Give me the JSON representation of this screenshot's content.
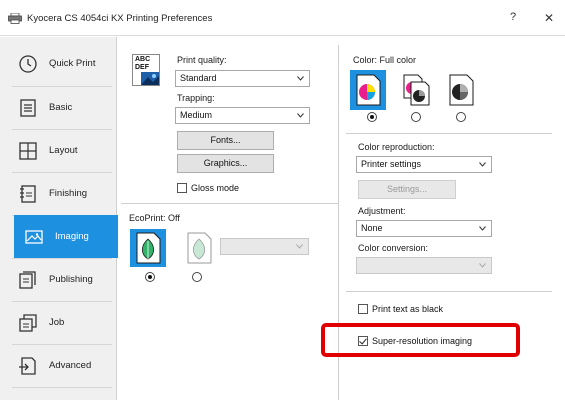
{
  "window": {
    "title": "Kyocera CS 4054ci KX Printing Preferences",
    "help_label": "?",
    "close_label": "✕"
  },
  "sidebar": {
    "items": [
      {
        "label": "Quick Print",
        "icon": "clock-icon"
      },
      {
        "label": "Basic",
        "icon": "document-lines-icon"
      },
      {
        "label": "Layout",
        "icon": "layout-grid-icon"
      },
      {
        "label": "Finishing",
        "icon": "finishing-icon"
      },
      {
        "label": "Imaging",
        "icon": "image-icon",
        "active": true
      },
      {
        "label": "Publishing",
        "icon": "publishing-icon"
      },
      {
        "label": "Job",
        "icon": "job-icon"
      },
      {
        "label": "Advanced",
        "icon": "advanced-icon"
      }
    ]
  },
  "quality": {
    "abc_label": "ABC",
    "def_label": "DEF",
    "print_quality_label": "Print quality:",
    "print_quality_value": "Standard",
    "trapping_label": "Trapping:",
    "trapping_value": "Medium",
    "fonts_button": "Fonts...",
    "graphics_button": "Graphics...",
    "gloss_mode_label": "Gloss mode",
    "gloss_mode_checked": false
  },
  "ecoprint": {
    "label": "EcoPrint:",
    "value": "Off",
    "selected_option": 0
  },
  "color": {
    "label": "Color:",
    "value": "Full color",
    "selected_option": 0,
    "reproduction_label": "Color reproduction:",
    "reproduction_value": "Printer settings",
    "settings_button": "Settings...",
    "adjustment_label": "Adjustment:",
    "adjustment_value": "None",
    "conversion_label": "Color conversion:",
    "conversion_value": ""
  },
  "options": {
    "print_text_black_label": "Print text as black",
    "print_text_black_checked": false,
    "super_resolution_label": "Super-resolution imaging",
    "super_resolution_checked": true
  },
  "colors": {
    "accent": "#1e90e0",
    "highlight": "#e00000"
  }
}
